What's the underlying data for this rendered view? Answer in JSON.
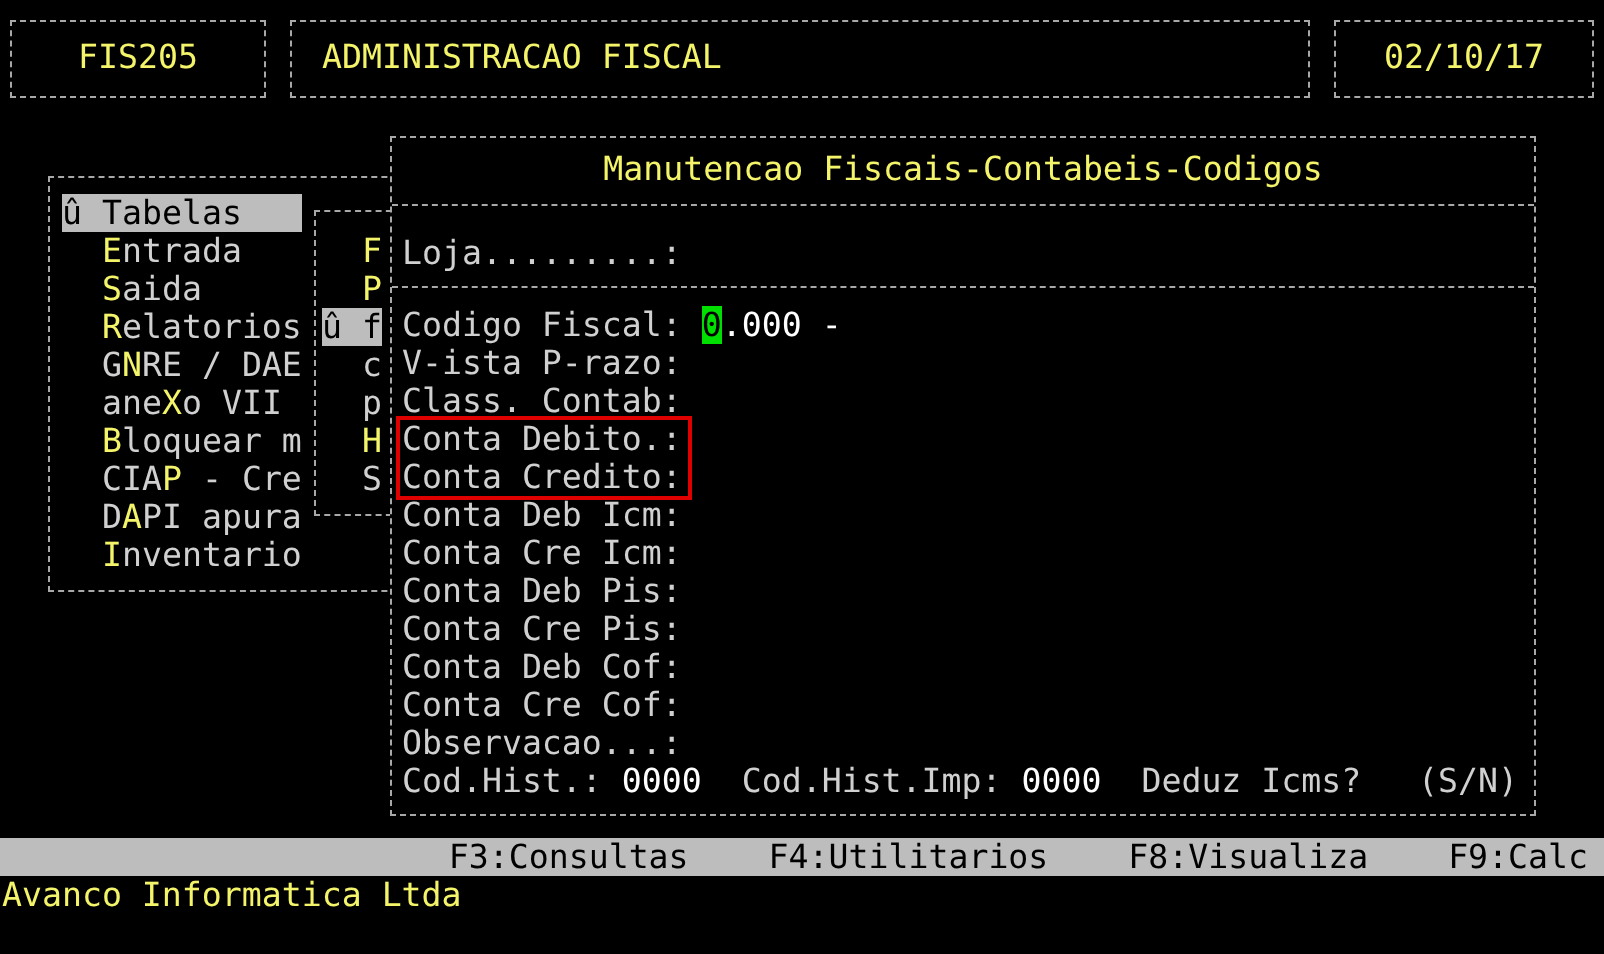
{
  "header": {
    "program_code": "FIS205",
    "module_title": "ADMINISTRACAO FISCAL",
    "date": "02/10/17"
  },
  "main_menu": {
    "items": [
      {
        "marker": "û",
        "post": "Tabelas",
        "selected": true
      },
      {
        "key": "E",
        "post": "ntrada",
        "selected": false
      },
      {
        "key": "S",
        "post": "aida",
        "selected": false
      },
      {
        "key": "R",
        "post": "elatorios",
        "selected": false
      },
      {
        "pre": "G",
        "key": "N",
        "post": "RE / DAE",
        "selected": false
      },
      {
        "pre": "ane",
        "key": "X",
        "post": "o VII",
        "selected": false
      },
      {
        "key": "B",
        "post": "loquear m",
        "selected": false
      },
      {
        "pre": "CIA",
        "key": "P",
        "post": " - Cre",
        "selected": false
      },
      {
        "pre": "D",
        "key": "A",
        "post": "PI apura",
        "selected": false
      },
      {
        "key": "I",
        "post": "nventario",
        "selected": false
      }
    ]
  },
  "sub_menu": {
    "items": [
      {
        "key": "F",
        "selected": false
      },
      {
        "key": "P",
        "selected": false
      },
      {
        "marker": "û",
        "post": "f",
        "selected": true
      },
      {
        "post": "c",
        "selected": false
      },
      {
        "post": "p",
        "selected": false
      },
      {
        "key": "H",
        "selected": false
      },
      {
        "post": "S",
        "selected": false
      }
    ]
  },
  "form": {
    "title": "Manutencao Fiscais-Contabeis-Codigos",
    "store_label": "Loja.........:",
    "fields": [
      {
        "label": "Codigo Fiscal:",
        "value": "0.000 -",
        "cursor": true,
        "highlighted": false
      },
      {
        "label": "V-ista P-razo:",
        "highlighted": false
      },
      {
        "label": "Class. Contab:",
        "highlighted": false
      },
      {
        "label": "Conta Debito.:",
        "highlighted": true
      },
      {
        "label": "Conta Credito:",
        "highlighted": true
      },
      {
        "label": "Conta Deb Icm:",
        "highlighted": false
      },
      {
        "label": "Conta Cre Icm:",
        "highlighted": false
      },
      {
        "label": "Conta Deb Pis:",
        "highlighted": false
      },
      {
        "label": "Conta Cre Pis:",
        "highlighted": false
      },
      {
        "label": "Conta Deb Cof:",
        "highlighted": false
      },
      {
        "label": "Conta Cre Cof:",
        "highlighted": false
      },
      {
        "label": "Observacao...:",
        "highlighted": false
      }
    ],
    "bottom_row": [
      {
        "label": "Cod.Hist.:",
        "value": "0000"
      },
      {
        "label": "Cod.Hist.Imp:",
        "value": "0000"
      },
      {
        "label": "Deduz Icms?",
        "value": "(S/N)"
      }
    ]
  },
  "function_keys": [
    "F3:Consultas",
    "F4:Utilitarios",
    "F8:Visualiza",
    "F9:Calc"
  ],
  "footer": "Avanco Informatica Ltda"
}
